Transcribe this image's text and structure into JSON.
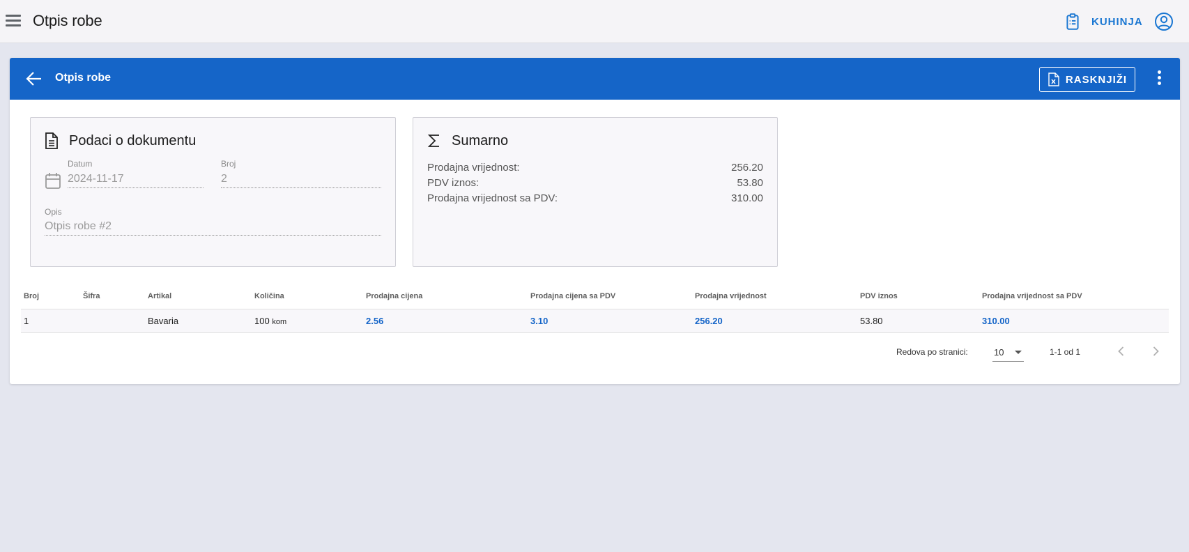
{
  "appbar": {
    "title": "Otpis robe",
    "kitchen_label": "KUHINJA"
  },
  "card": {
    "title": "Otpis robe",
    "rasknjizi_label": "RASKNJIŽI"
  },
  "document_panel": {
    "title": "Podaci o dokumentu",
    "date_label": "Datum",
    "date_value": "2024-11-17",
    "number_label": "Broj",
    "number_value": "2",
    "description_label": "Opis",
    "description_value": "Otpis robe #2"
  },
  "summary_panel": {
    "title": "Sumarno",
    "rows": [
      {
        "label": "Prodajna vrijednost:",
        "value": "256.20"
      },
      {
        "label": "PDV iznos:",
        "value": "53.80"
      },
      {
        "label": "Prodajna vrijednost sa PDV:",
        "value": "310.00"
      }
    ]
  },
  "table": {
    "headers": [
      "Broj",
      "Šifra",
      "Artikal",
      "Količina",
      "Prodajna cijena",
      "Prodajna cijena sa PDV",
      "Prodajna vrijednost",
      "PDV iznos",
      "Prodajna vrijednost sa PDV"
    ],
    "rows": [
      {
        "broj": "1",
        "sifra": "",
        "artikal": "Bavaria",
        "kolicina": "100",
        "jedinica": "kom",
        "prodajna_cijena": "2.56",
        "prodajna_cijena_pdv": "3.10",
        "prodajna_vrijednost": "256.20",
        "pdv_iznos": "53.80",
        "prodajna_vrijednost_pdv": "310.00"
      }
    ]
  },
  "pagination": {
    "rows_per_page_label": "Redova po stranici:",
    "rows_per_page_value": "10",
    "range_text": "1-1 od 1"
  },
  "colors": {
    "primary": "#1565c8",
    "accent_text": "#1976d2",
    "background": "#e4e6ef"
  }
}
